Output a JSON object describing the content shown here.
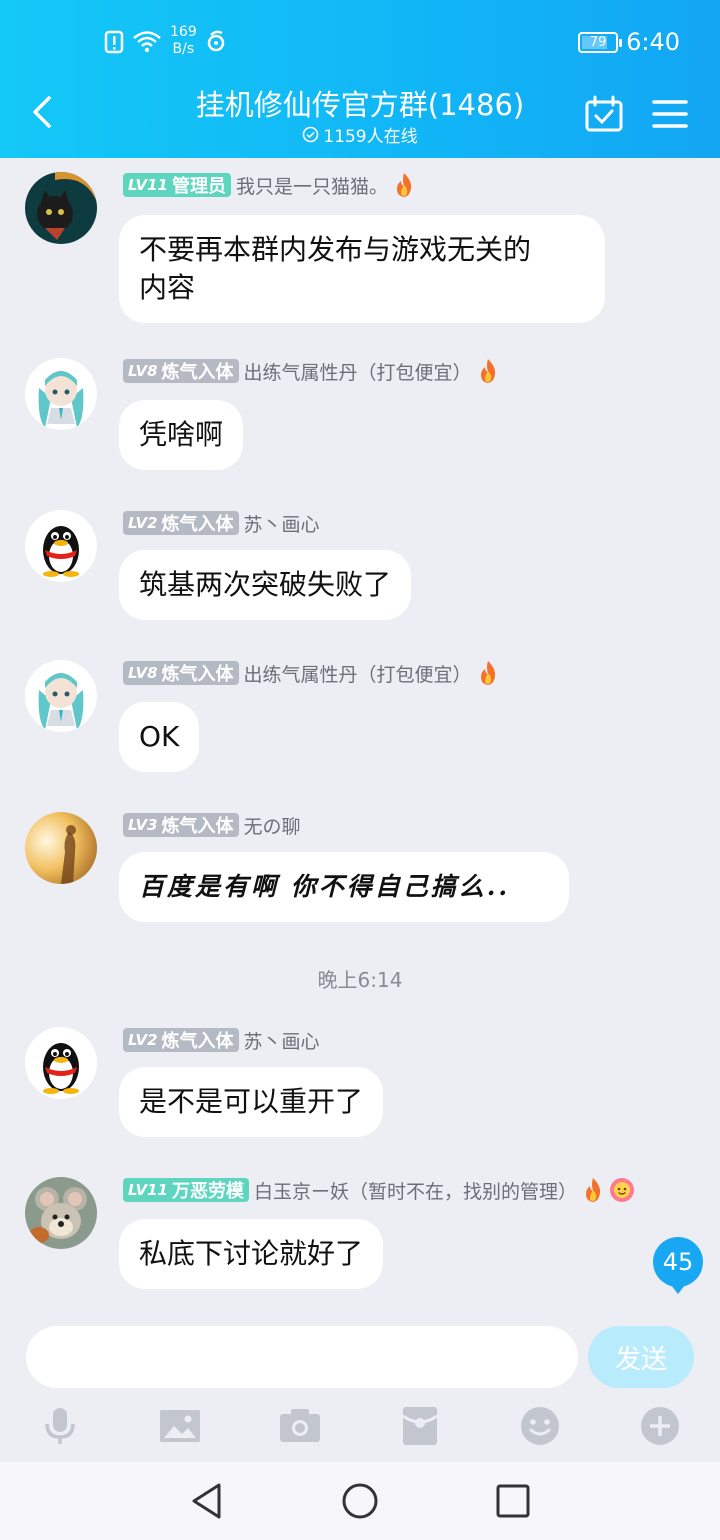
{
  "status_bar": {
    "speed_value": "169",
    "speed_unit": "B/s",
    "battery": "79",
    "time": "6:40"
  },
  "header": {
    "title": "挂机修仙传官方群(1486)",
    "online": "1159人在线"
  },
  "messages": [
    {
      "level": "LV11",
      "title": "管理员",
      "nickname": "我只是一只猫猫。",
      "text_line1": "不要再本群内发布与游戏无关的",
      "text_line2": "内容"
    },
    {
      "level": "LV8",
      "title": "炼气入体",
      "nickname": "出练气属性丹（打包便宜）",
      "text": "凭啥啊"
    },
    {
      "level": "LV2",
      "title": "炼气入体",
      "nickname": "苏丶画心",
      "text": "筑基两次突破失败了"
    },
    {
      "level": "LV8",
      "title": "炼气入体",
      "nickname": "出练气属性丹（打包便宜）",
      "text": "OK"
    },
    {
      "level": "LV3",
      "title": "炼气入体",
      "nickname": "无の聊",
      "text": "百度是有啊 你不得自己搞么.."
    },
    {
      "level": "LV2",
      "title": "炼气入体",
      "nickname": "苏丶画心",
      "text": "是不是可以重开了"
    },
    {
      "level": "LV11",
      "title": "万恶劳模",
      "nickname": "白玉京ー妖（暂时不在，找别的管理）",
      "text": "私底下讨论就好了"
    }
  ],
  "timestamp": "晚上6:14",
  "unread_count": "45",
  "input": {
    "placeholder": "",
    "send_label": "发送"
  },
  "toolbar_icons": [
    "microphone-icon",
    "image-icon",
    "camera-icon",
    "red-packet-icon",
    "emoji-icon",
    "plus-icon"
  ],
  "colors": {
    "header": "#14b8f6",
    "admin_badge": "#5dd5bf",
    "level_badge": "#b5b9c4",
    "send": "#b8ecfc"
  }
}
